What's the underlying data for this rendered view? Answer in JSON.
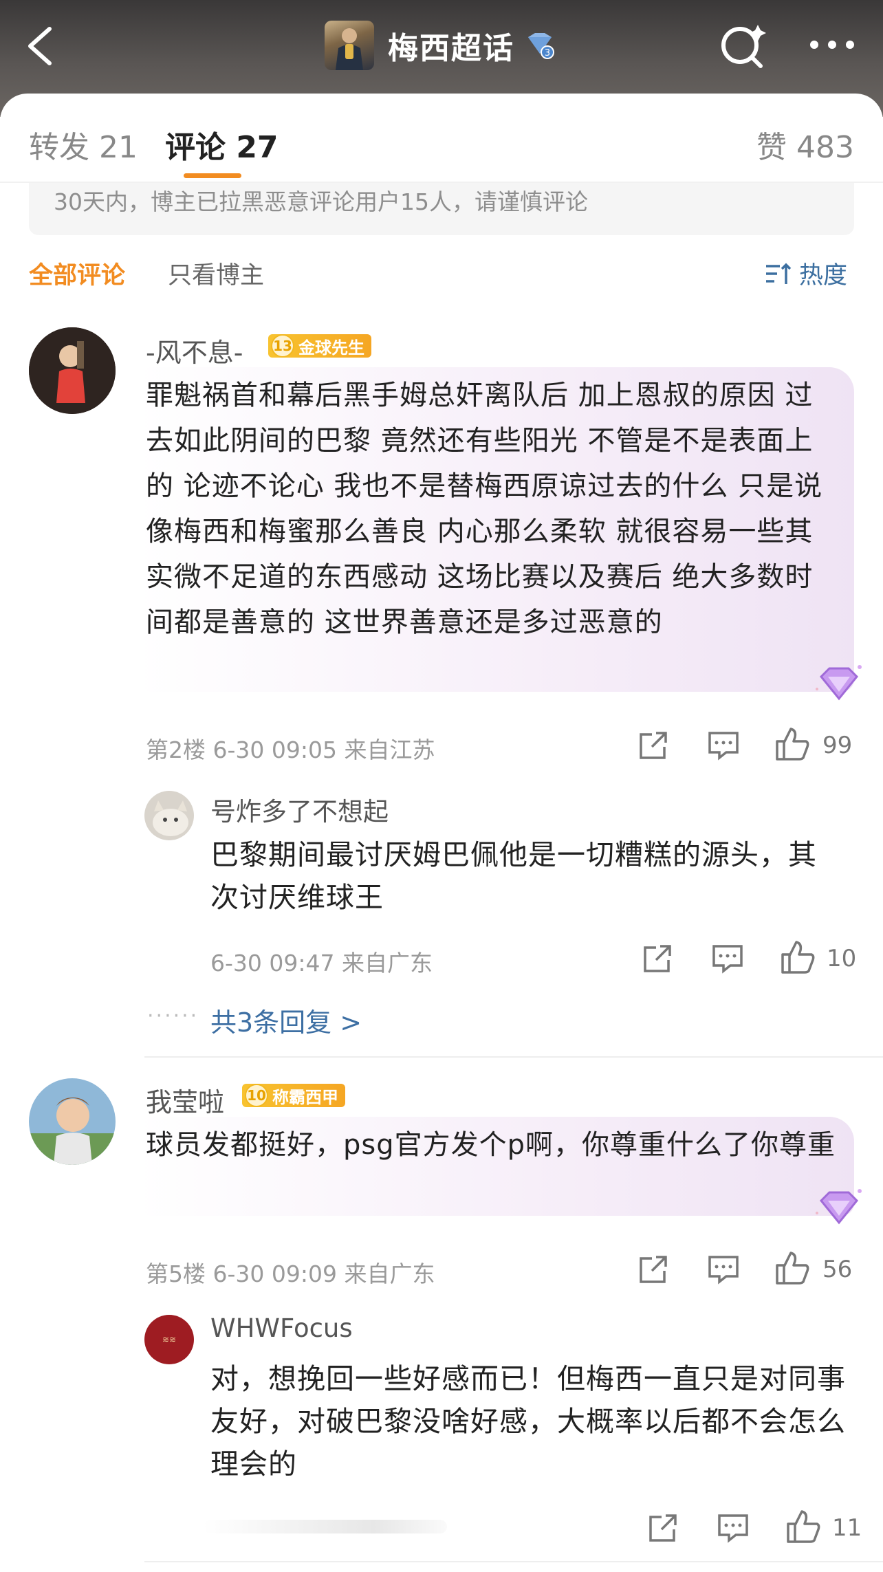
{
  "header": {
    "title": "梅西超话",
    "diamond_level": "3"
  },
  "tabs": {
    "repost": "转发 21",
    "comments": "评论 27",
    "likes": "赞 483"
  },
  "notice": "30天内，博主已拉黑恶意评论用户15人，请谨慎评论",
  "filters": {
    "all": "全部评论",
    "author_only": "只看博主",
    "sort": "热度"
  },
  "comments": [
    {
      "username": "-风不息-",
      "badge_level": "13",
      "badge_text": "金球先生",
      "text": "罪魁祸首和幕后黑手姆总奸离队后 加上恩叔的原因 过去如此阴间的巴黎 竟然还有些阳光 不管是不是表面上的 论迹不论心 我也不是替梅西原谅过去的什么 只是说像梅西和梅蜜那么善良 内心那么柔软 就很容易一些其实微不足道的东西感动 这场比赛以及赛后 绝大多数时间都是善意的 这世界善意还是多过恶意的",
      "meta": "第2楼  6-30 09:05  来自江苏",
      "likes": "99",
      "reply": {
        "username": "号炸多了不想起",
        "text": "巴黎期间最讨厌姆巴佩他是一切糟糕的源头，其次讨厌维球王",
        "meta": "6-30 09:47  来自广东",
        "likes": "10"
      },
      "more_replies": "共3条回复 >"
    },
    {
      "username": "我莹啦",
      "badge_level": "10",
      "badge_text": "称霸西甲",
      "text": "球员发都挺好，psg官方发个p啊，你尊重什么了你尊重",
      "meta": "第5楼  6-30 09:09  来自广东",
      "likes": "56",
      "reply": {
        "username": "WHWFocus",
        "text": "对，想挽回一些好感而已！但梅西一直只是对同事友好，对破巴黎没啥好感，大概率以后都不会怎么理会的",
        "meta": "",
        "likes": "11"
      }
    }
  ],
  "colors": {
    "accent": "#f28c21",
    "link": "#3d6fa3",
    "header_bg": "#4a4746"
  }
}
